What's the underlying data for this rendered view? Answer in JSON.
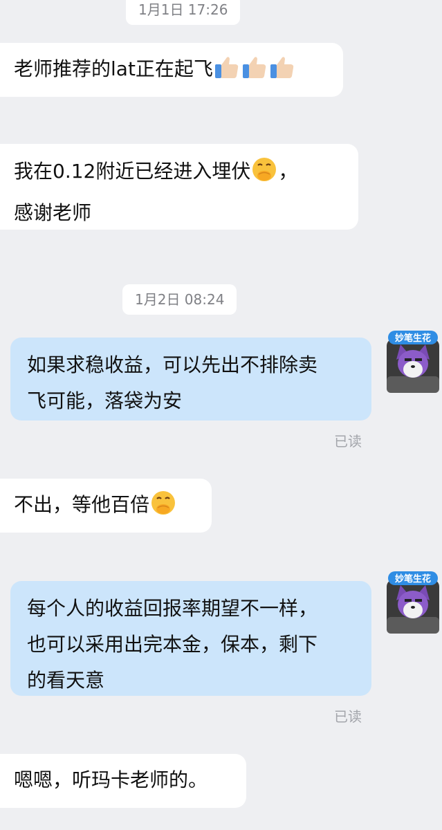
{
  "messages": {
    "ts1": "1月1日 17:26",
    "m1_text": "老师推荐的lat正在起飞",
    "m1_emoji": [
      "thumbs-up-icon",
      "thumbs-up-icon",
      "thumbs-up-icon"
    ],
    "m2_line1": "我在0.12附近已经进入埋伏",
    "m2_line1_end": "，",
    "m2_line2": "感谢老师",
    "ts2": "1月2日 08:24",
    "m3_line1": "如果求稳收益，可以先出不排除卖",
    "m3_line2": "飞可能，落袋为安",
    "m3_status": "已读",
    "m4_text": "不出，等他百倍",
    "m5_line1": "每个人的收益回报率期望不一样，",
    "m5_line2": "也可以采用出完本金，保本，剩下",
    "m5_line3": "的看天意",
    "m5_status": "已读",
    "m6_text": "嗯嗯，听玛卡老师的。"
  },
  "avatar": {
    "badge_text": "妙笔生花",
    "icon": "shiba-dog-avatar-icon"
  },
  "colors": {
    "background": "#eeeff2",
    "incoming_bubble": "#ffffff",
    "outgoing_bubble": "#cce5fb",
    "read_mark": "#a3a5ab"
  }
}
